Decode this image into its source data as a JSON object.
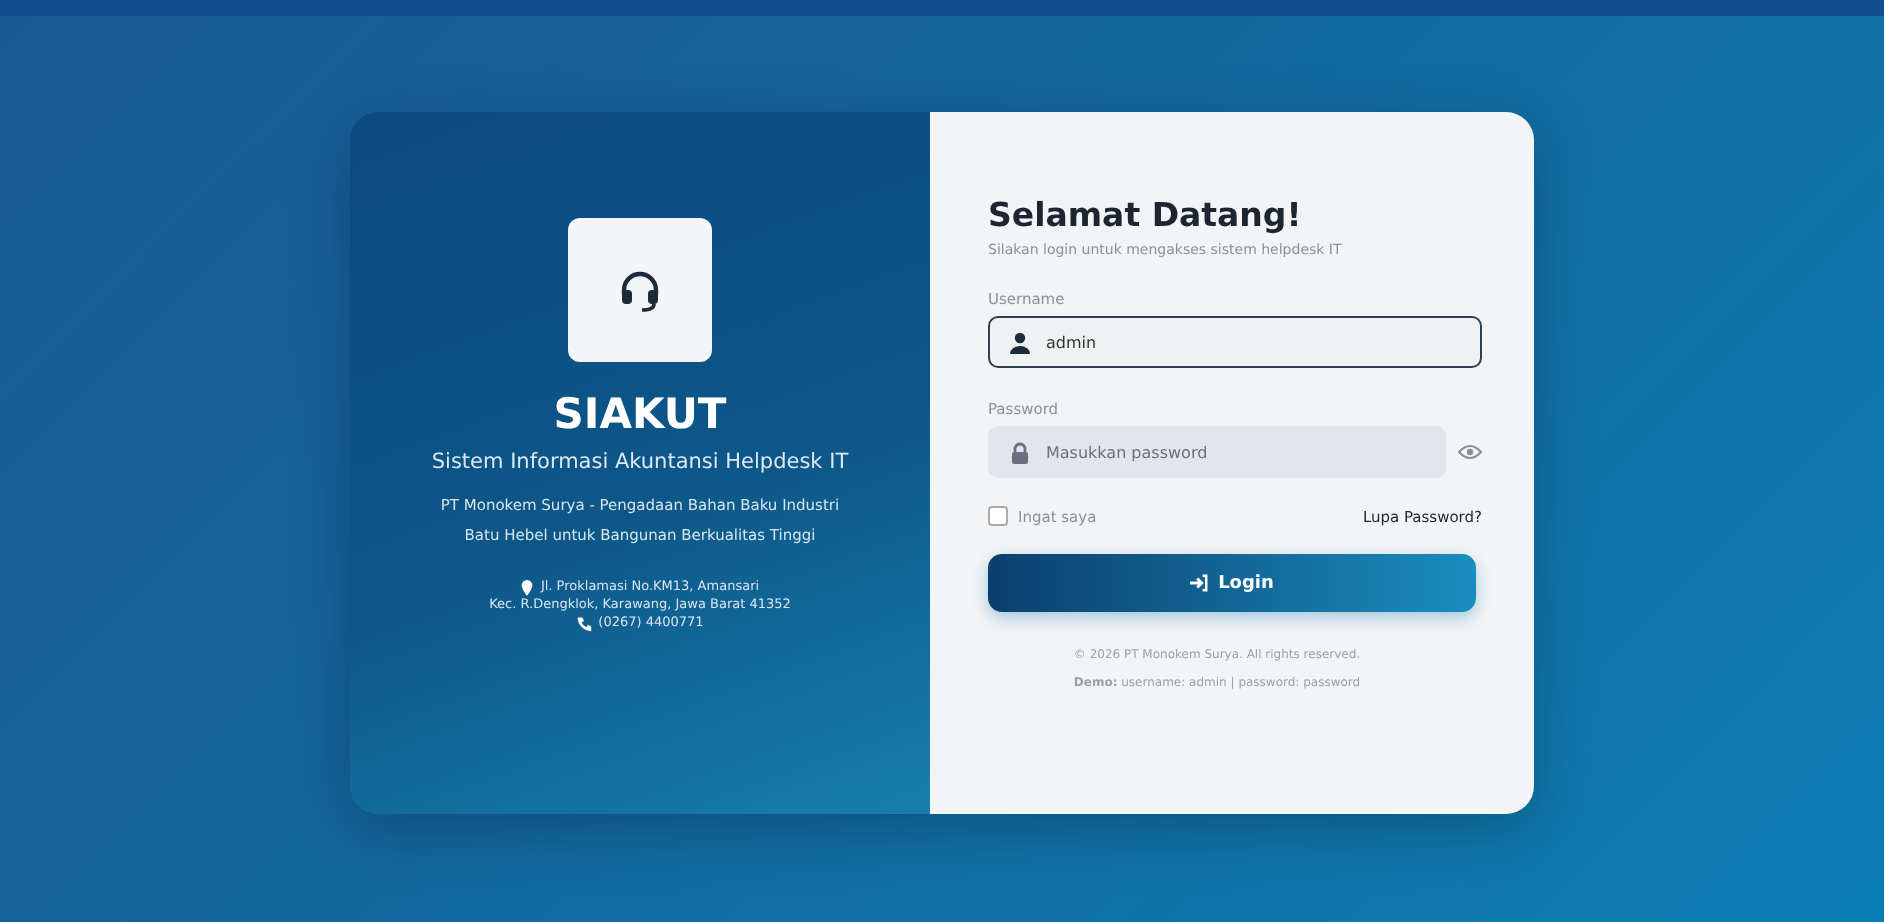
{
  "brand": {
    "title": "SIAKUT",
    "subtitle": "Sistem Informasi Akuntansi Helpdesk IT",
    "description": "PT Monokem Surya - Pengadaan Bahan Baku Industri Batu Hebel untuk Bangunan Berkualitas Tinggi",
    "address_lines": [
      "Jl. Proklamasi No.KM13, Amansari",
      "Kec. R.Dengklok, Karawang, Jawa Barat 41352"
    ],
    "phone": "(0267) 4400771"
  },
  "login": {
    "title": "Selamat Datang!",
    "subtitle": "Silakan login untuk mengakses sistem helpdesk IT",
    "fields": [
      {
        "kind": "text",
        "label": "Username",
        "value": "admin",
        "focused": true
      },
      {
        "kind": "password",
        "label": "Password",
        "placeholder": "Masukkan password",
        "focused": false
      }
    ],
    "remember": {
      "label": "Ingat saya",
      "checked": false
    },
    "forgot": "Lupa Password?",
    "button": "Login",
    "copyright": "© 2026 PT Monokem Surya. All rights reserved.",
    "demo": "**Demo:** username: admin | password: password"
  }
}
